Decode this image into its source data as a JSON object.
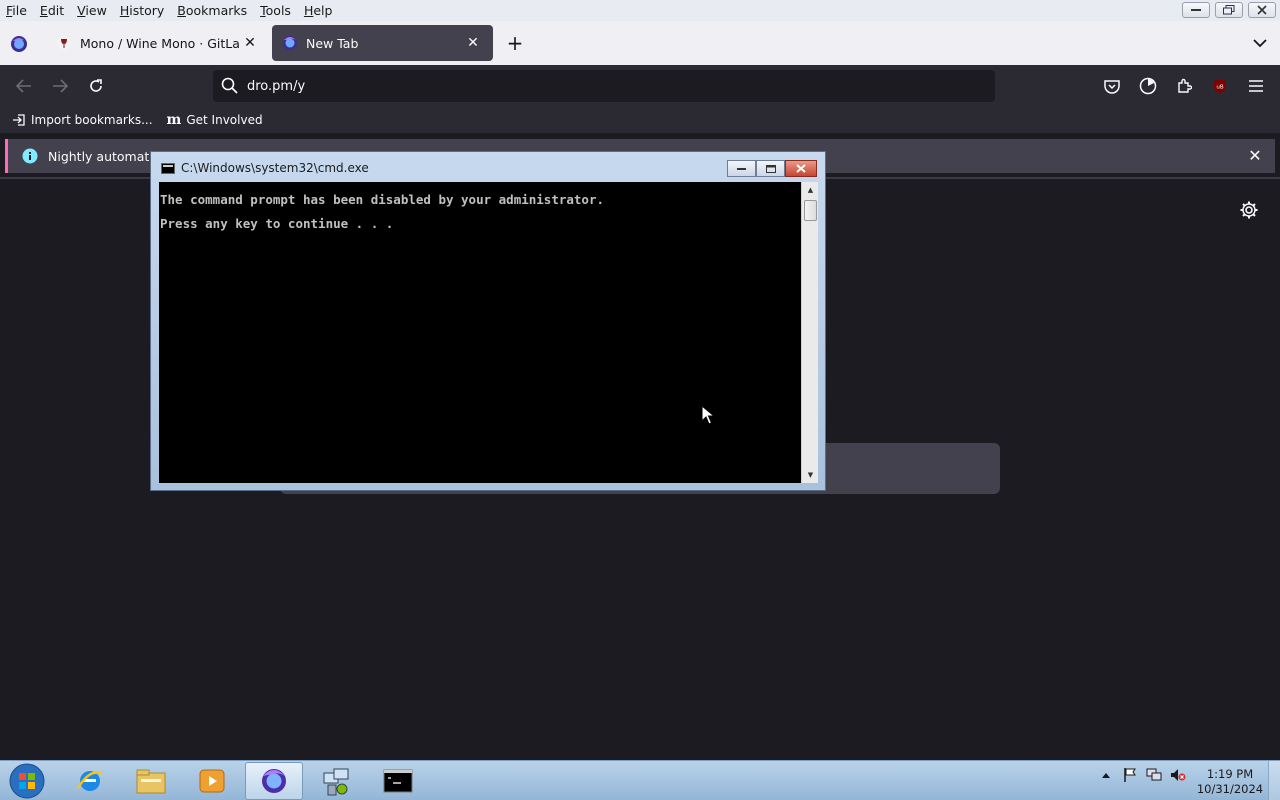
{
  "menubar": {
    "items": [
      {
        "label": "File",
        "accel": "F",
        "rest": "ile"
      },
      {
        "label": "Edit",
        "accel": "E",
        "rest": "dit"
      },
      {
        "label": "View",
        "accel": "V",
        "rest": "iew"
      },
      {
        "label": "History",
        "accel": "H",
        "rest": "istory"
      },
      {
        "label": "Bookmarks",
        "accel": "B",
        "rest": "ookmarks"
      },
      {
        "label": "Tools",
        "accel": "T",
        "rest": "ools"
      },
      {
        "label": "Help",
        "accel": "H",
        "rest": "elp"
      }
    ]
  },
  "tabs": [
    {
      "title": "Mono / Wine Mono · GitLab",
      "icon": "wine-icon",
      "active": false
    },
    {
      "title": "New Tab",
      "icon": "firefox-nightly-icon",
      "active": true
    }
  ],
  "navbar": {
    "url": "dro.pm/y",
    "icons": [
      "back-icon",
      "forward-icon",
      "reload-icon",
      "pocket-icon",
      "sync-icon",
      "extensions-icon",
      "ublock-icon",
      "menu-icon"
    ]
  },
  "bookmarks": [
    {
      "label": "Import bookmarks...",
      "icon": "import-icon"
    },
    {
      "label": "Get Involved",
      "icon": "mozilla-m-icon",
      "icon_glyph": "m"
    }
  ],
  "notification": {
    "text": "Nightly automatical",
    "accent": "#ff6bba"
  },
  "cmd": {
    "title": "C:\\Windows\\system32\\cmd.exe",
    "lines": [
      "The command prompt has been disabled by your administrator.",
      "Press any key to continue . . ."
    ]
  },
  "taskbar": {
    "items": [
      "ie-icon",
      "explorer-icon",
      "media-player-icon",
      "firefox-icon",
      "network-admin-icon",
      "cmd-icon"
    ],
    "active_index": 3,
    "clock_time": "1:19 PM",
    "clock_date": "10/31/2024",
    "tray": [
      "show-hidden-icon",
      "action-center-flag-icon",
      "network-icon",
      "volume-muted-icon"
    ]
  }
}
